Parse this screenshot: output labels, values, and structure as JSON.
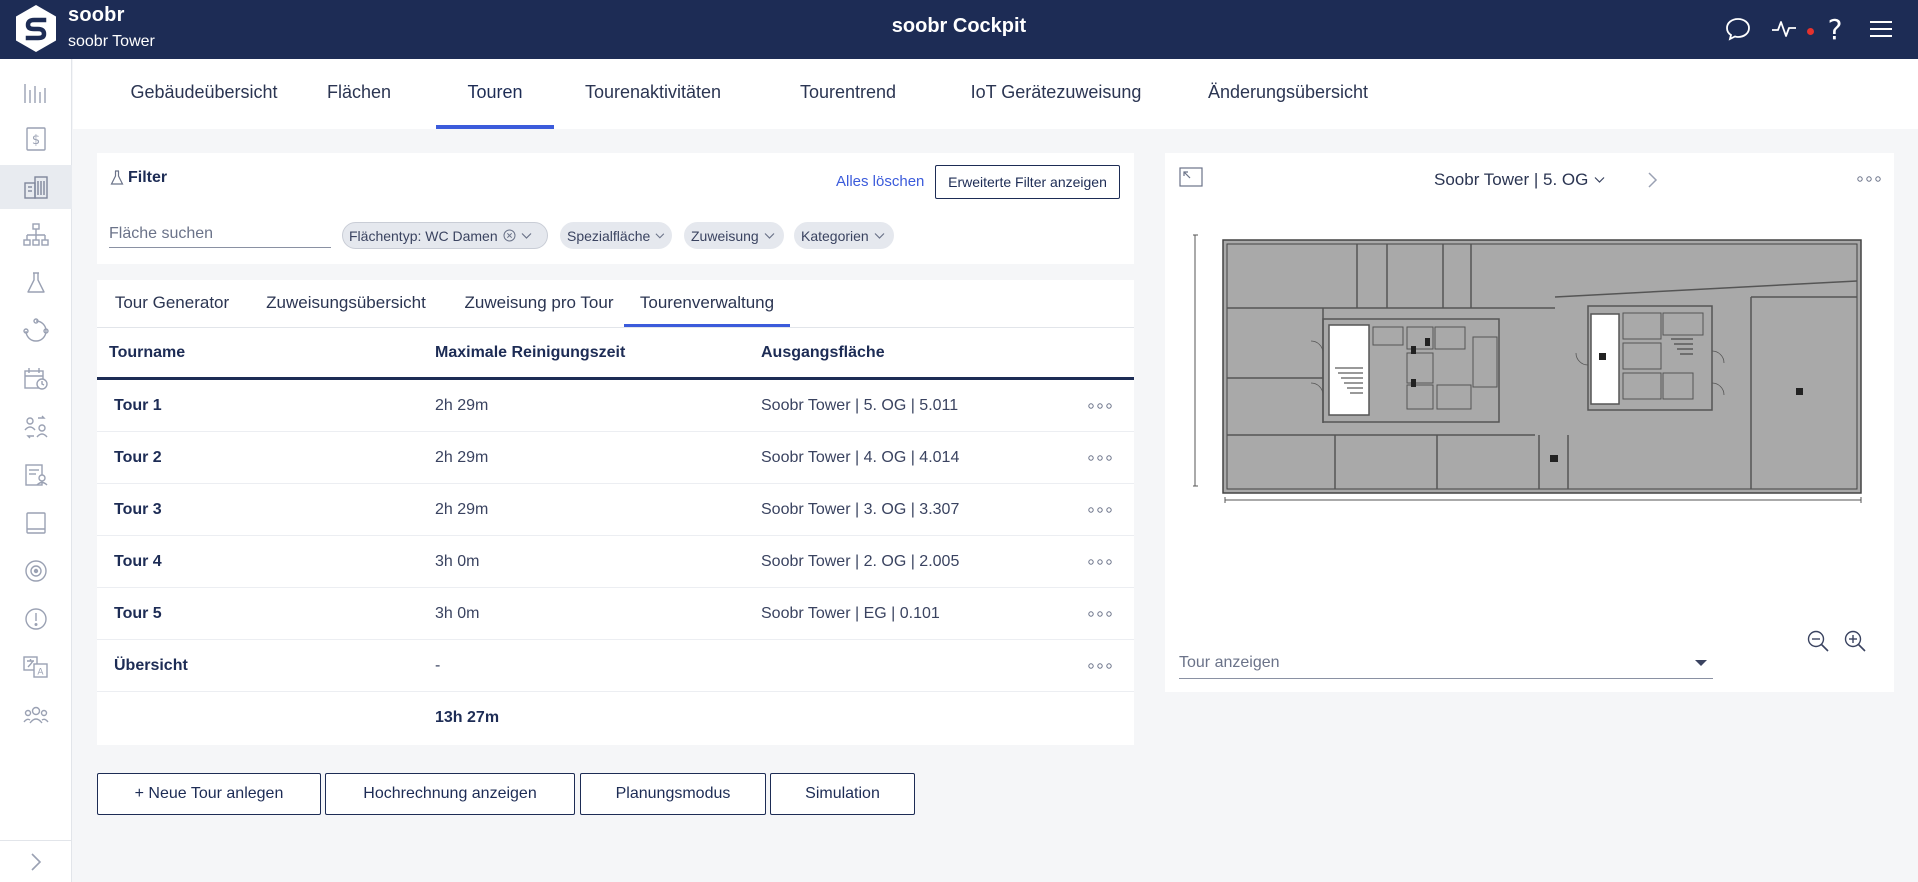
{
  "header": {
    "brand": "soobr",
    "building": "soobr Tower",
    "app_title": "soobr Cockpit",
    "help_glyph": "?"
  },
  "sidebar": {
    "items": [
      {
        "icon": "bar-chart-icon"
      },
      {
        "icon": "dollar-document-icon"
      },
      {
        "icon": "building-icon",
        "active": true
      },
      {
        "icon": "org-chart-icon"
      },
      {
        "icon": "flask-icon"
      },
      {
        "icon": "cycle-arrows-icon"
      },
      {
        "icon": "calendar-clock-icon"
      },
      {
        "icon": "user-swap-icon"
      },
      {
        "icon": "document-user-icon"
      },
      {
        "icon": "tablet-icon"
      },
      {
        "icon": "sensor-icon"
      },
      {
        "icon": "alert-circle-icon"
      },
      {
        "icon": "translate-icon"
      },
      {
        "icon": "team-icon"
      }
    ],
    "collapse_icon": "chevron-right-icon"
  },
  "nav": {
    "tabs": [
      "Gebäudeübersicht",
      "Flächen",
      "Touren",
      "Tourenaktivitäten",
      "Tourentrend",
      "IoT Gerätezuweisung",
      "Änderungsübersicht"
    ],
    "active": "Touren"
  },
  "filter": {
    "title": "Filter",
    "clear_label": "Alles löschen",
    "advanced_label": "Erweiterte Filter anzeigen",
    "search_placeholder": "Fläche suchen",
    "chips": [
      "Flächentyp: WC Damen",
      "Spezialfläche",
      "Zuweisung",
      "Kategorien"
    ]
  },
  "subtabs": {
    "items": [
      "Tour Generator",
      "Zuweisungsübersicht",
      "Zuweisung pro Tour",
      "Tourenverwaltung"
    ],
    "active": "Tourenverwaltung"
  },
  "table": {
    "headers": [
      "Tourname",
      "Maximale Reinigungszeit",
      "Ausgangsfläche"
    ],
    "rows": [
      {
        "name": "Tour 1",
        "time": "2h 29m",
        "area": "Soobr Tower | 5. OG | 5.011"
      },
      {
        "name": "Tour 2",
        "time": "2h 29m",
        "area": "Soobr Tower | 4. OG | 4.014"
      },
      {
        "name": "Tour 3",
        "time": "2h 29m",
        "area": "Soobr Tower | 3. OG | 3.307"
      },
      {
        "name": "Tour 4",
        "time": "3h 0m",
        "area": "Soobr Tower | 2. OG | 2.005"
      },
      {
        "name": "Tour 5",
        "time": "3h 0m",
        "area": "Soobr Tower | EG | 0.101"
      },
      {
        "name": "Übersicht",
        "time": "-",
        "area": ""
      }
    ],
    "total": "13h 27m"
  },
  "actions": [
    "+ Neue Tour anlegen",
    "Hochrechnung anzeigen",
    "Planungsmodus",
    "Simulation"
  ],
  "map": {
    "floor": "Soobr Tower | 5. OG",
    "tour_select_label": "Tour anzeigen"
  },
  "colors": {
    "header_bg": "#1d2c55",
    "accent": "#3b5bdb",
    "alert_dot": "#e5322d",
    "floor_fill": "#a9a9a9"
  }
}
